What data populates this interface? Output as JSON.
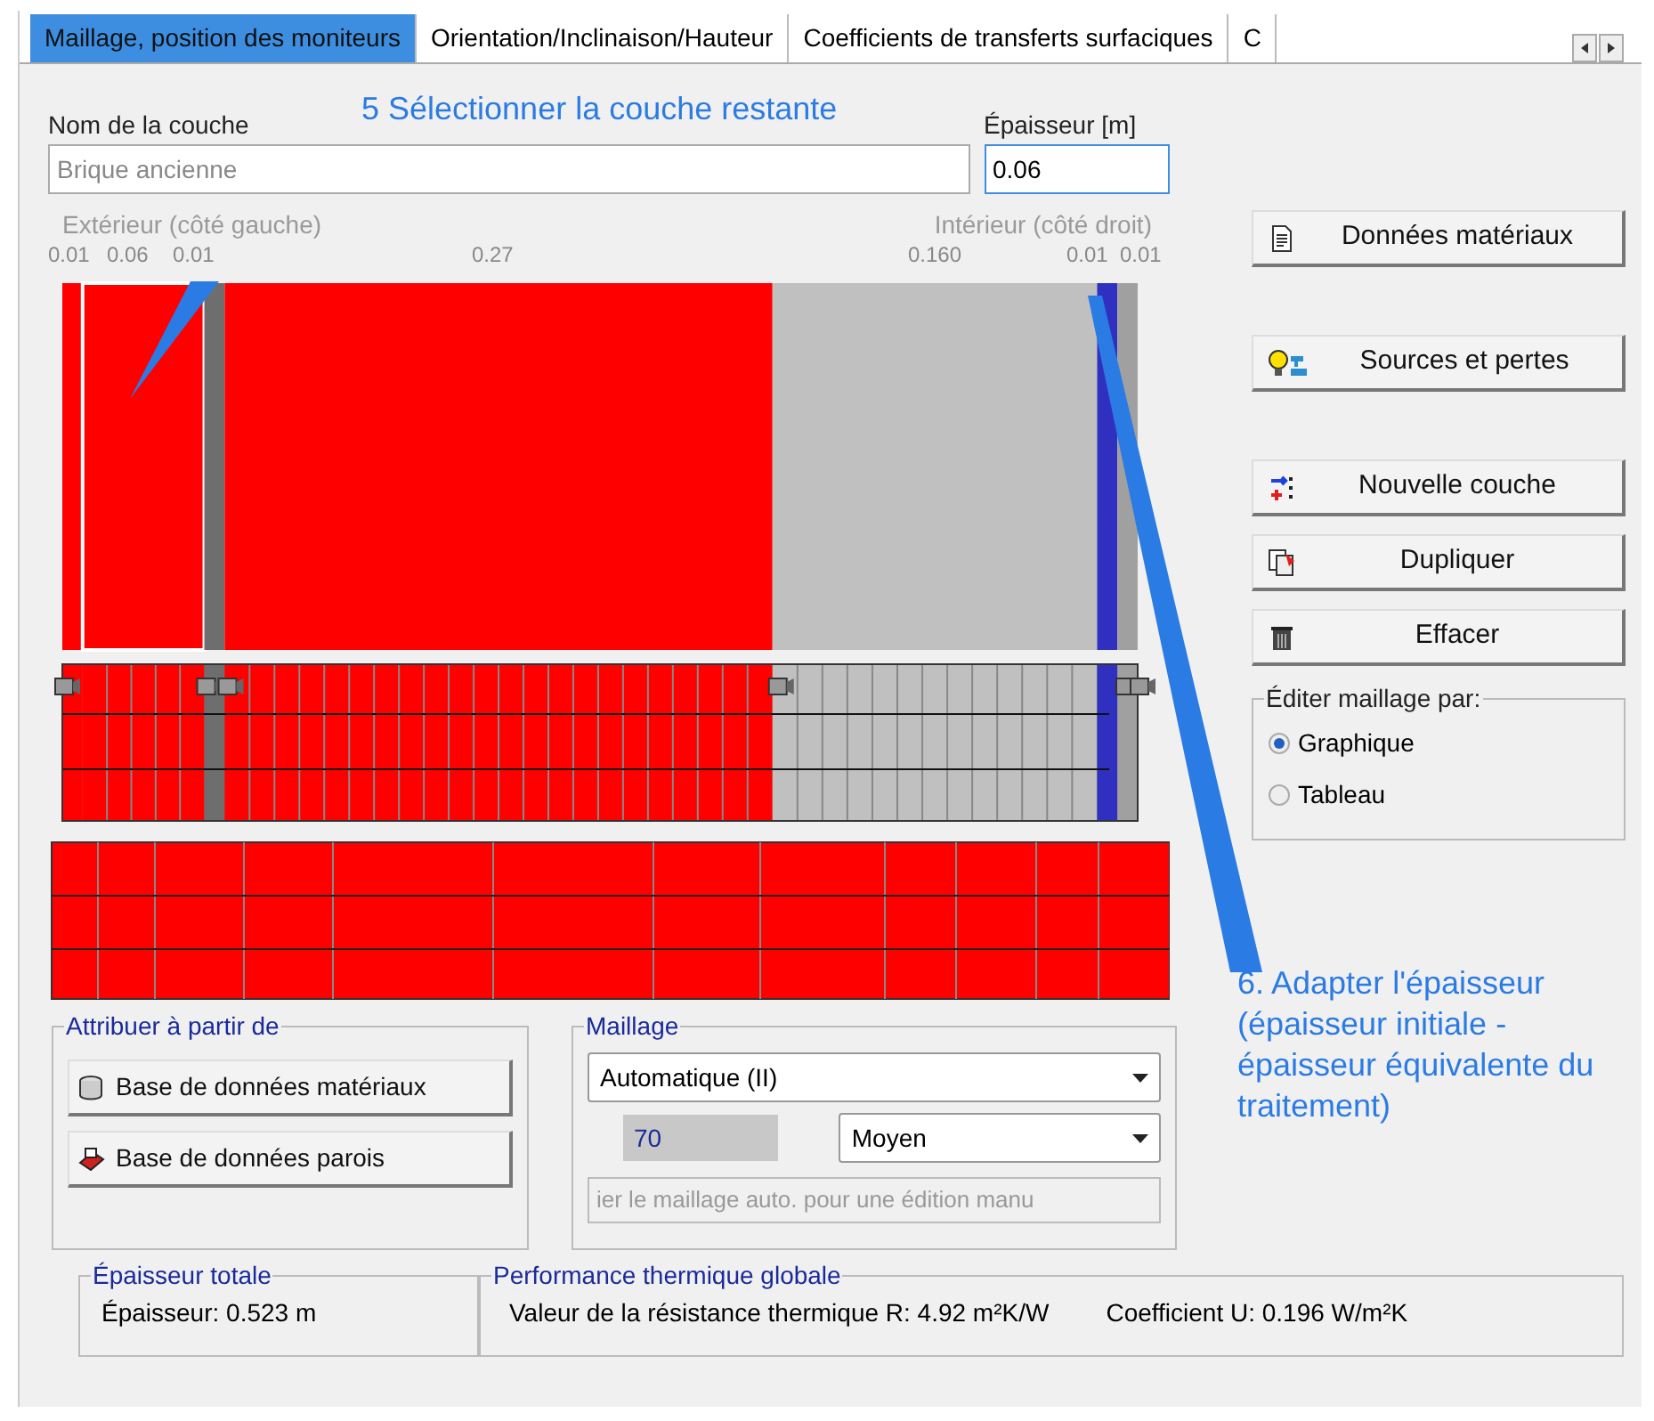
{
  "tabs": [
    {
      "label": "Maillage, position des moniteurs",
      "selected": true
    },
    {
      "label": "Orientation/Inclinaison/Hauteur",
      "selected": false
    },
    {
      "label": "Coefficients de transferts surfaciques",
      "selected": false
    },
    {
      "label": "C",
      "selected": false
    }
  ],
  "layer_name": {
    "label": "Nom de la couche",
    "placeholder": "Brique ancienne"
  },
  "thickness": {
    "label": "Épaisseur [m]",
    "value": "0.06"
  },
  "diagram": {
    "exterior_label": "Extérieur (côté gauche)",
    "interior_label": "Intérieur (côté droit)",
    "layers": [
      {
        "thickness": "0.01",
        "color": "#ff0000",
        "selected": false
      },
      {
        "thickness": "0.06",
        "color": "#ff0000",
        "selected": true
      },
      {
        "thickness": "0.01",
        "color": "#6e6e6e",
        "selected": false
      },
      {
        "thickness": "0.27",
        "color": "#ff0000",
        "selected": false
      },
      {
        "thickness": "0.160",
        "color": "#c0c0c0",
        "selected": false
      },
      {
        "thickness": "0.01",
        "color": "#3030c0",
        "selected": false
      },
      {
        "thickness": "0.01",
        "color": "#a0a0a0",
        "selected": false
      }
    ]
  },
  "side_buttons": [
    {
      "kind": "materials",
      "label": "Données matériaux"
    },
    {
      "kind": "sources",
      "label": "Sources et pertes"
    },
    {
      "kind": "new",
      "label": "Nouvelle couche"
    },
    {
      "kind": "duplicate",
      "label": "Dupliquer"
    },
    {
      "kind": "delete",
      "label": "Effacer"
    }
  ],
  "edit_mesh": {
    "title": "Éditer maillage par:",
    "options": [
      {
        "label": "Graphique",
        "selected": true
      },
      {
        "label": "Tableau",
        "selected": false
      }
    ]
  },
  "assign": {
    "title": "Attribuer à partir de",
    "buttons": [
      {
        "kind": "materials_db",
        "label": "Base de données matériaux"
      },
      {
        "kind": "walls_db",
        "label": "Base de données parois"
      }
    ]
  },
  "meshing": {
    "title": "Maillage",
    "method": "Automatique (II)",
    "count": "70",
    "density": "Moyen",
    "manual_button": {
      "label": "ier le maillage auto. pour une édition manu",
      "disabled": true
    }
  },
  "total_thickness": {
    "title": "Épaisseur totale",
    "text": "Épaisseur: 0.523 m"
  },
  "performance": {
    "title": "Performance thermique globale",
    "r_text": "Valeur de la résistance thermique R: 4.92 m²K/W",
    "u_text": "Coefficient U: 0.196 W/m²K"
  },
  "callouts": [
    {
      "text": "5 Sélectionner la couche restante"
    },
    {
      "text": "6. Adapter l'épaisseur (épaisseur initiale - épaisseur équivalente du traitement)"
    }
  ]
}
